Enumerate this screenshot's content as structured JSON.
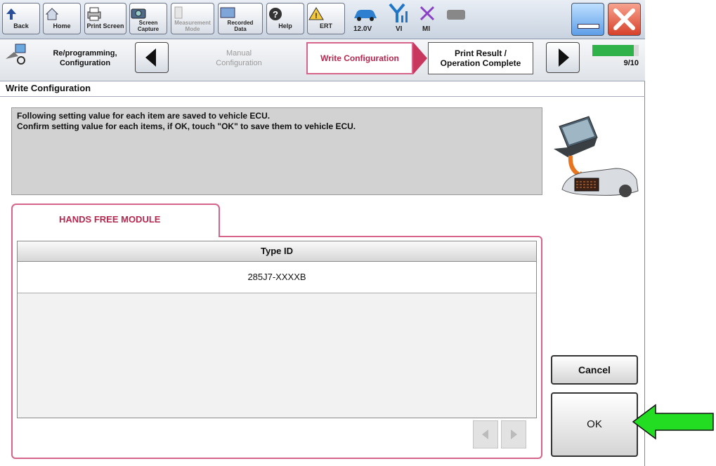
{
  "toolbar": {
    "back": "Back",
    "home": "Home",
    "print_screen": "Print Screen",
    "screen_capture": "Screen\nCapture",
    "measurement_mode": "Measurement\nMode",
    "recorded_data": "Recorded\nData",
    "help": "Help",
    "ert": "ERT",
    "battery_voltage": "12.0V",
    "vi": "VI",
    "mi": "MI"
  },
  "nav": {
    "reprogramming": "Re/programming,\nConfiguration",
    "manual_configuration": "Manual\nConfiguration",
    "write_configuration": "Write Configuration",
    "print_result": "Print Result /\nOperation Complete",
    "step_counter": "9/10",
    "progress_fraction": 0.9
  },
  "page": {
    "title": "Write Configuration",
    "message_line1": "Following setting value for each item are saved to vehicle ECU.",
    "message_line2": "Confirm setting value for each items, if OK, touch \"OK\" to save them to vehicle ECU."
  },
  "tab": {
    "label": "HANDS FREE MODULE"
  },
  "table": {
    "header": "Type ID",
    "rows": [
      "285J7-XXXXB"
    ]
  },
  "buttons": {
    "cancel": "Cancel",
    "ok": "OK"
  },
  "colors": {
    "accent_pink": "#d5638a",
    "pointer_arrow": "#22dd22"
  }
}
